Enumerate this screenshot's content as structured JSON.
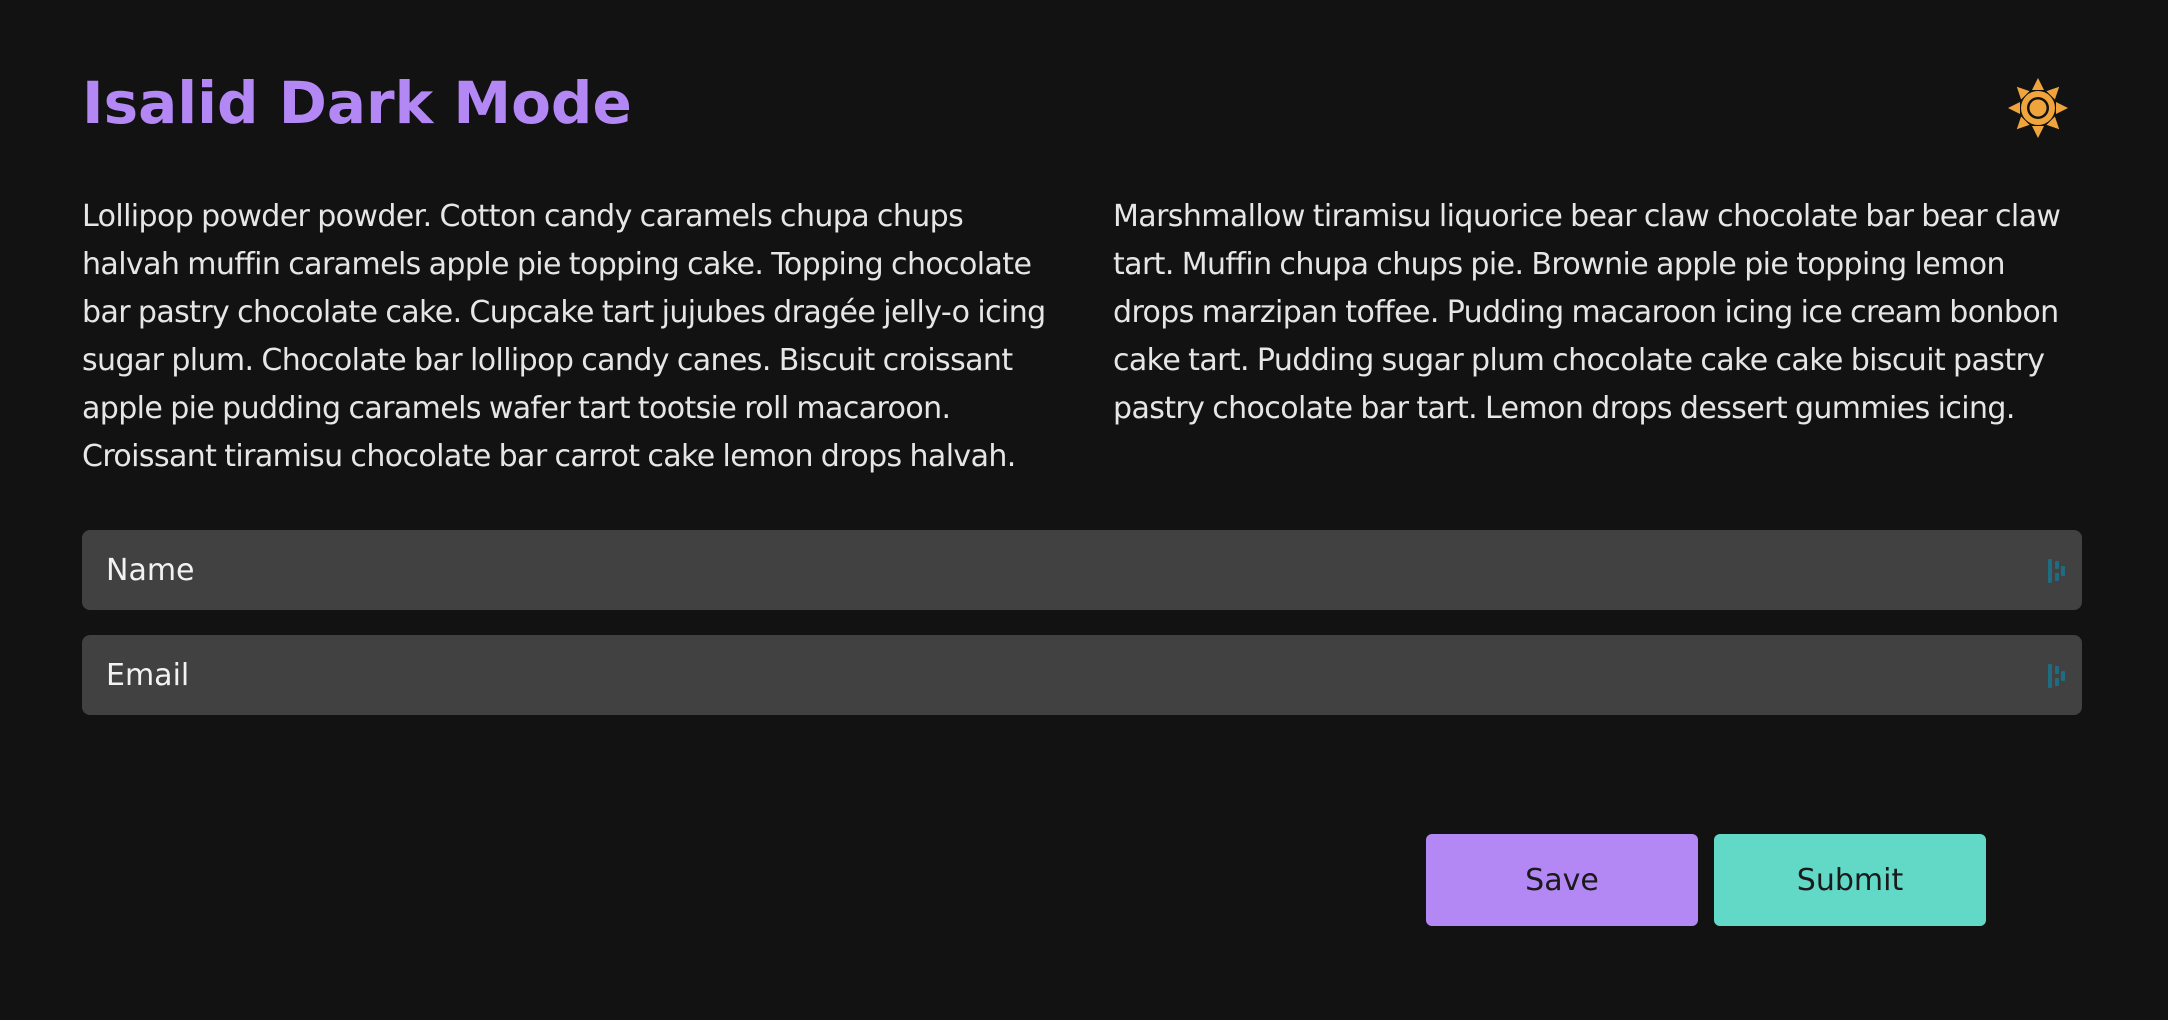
{
  "header": {
    "title": "Isalid Dark Mode",
    "theme_toggle_icon": "sun-icon",
    "theme_toggle_color": "#f0a53c"
  },
  "content": {
    "paragraph_left": "Lollipop powder powder. Cotton candy caramels chupa chups halvah muffin caramels apple pie topping cake. Topping chocolate bar pastry chocolate cake. Cupcake tart jujubes dragée jelly-o icing sugar plum. Chocolate bar lollipop candy canes. Biscuit croissant apple pie pudding caramels wafer tart tootsie roll macaroon. Croissant tiramisu chocolate bar carrot cake lemon drops halvah.",
    "paragraph_right": "Marshmallow tiramisu liquorice bear claw chocolate bar bear claw tart. Muffin chupa chups pie. Brownie apple pie topping lemon drops marzipan toffee. Pudding macaroon icing ice cream bonbon cake tart. Pudding sugar plum chocolate cake cake biscuit pastry pastry chocolate bar tart. Lemon drops dessert gummies icing."
  },
  "form": {
    "name_placeholder": "Name",
    "name_value": "",
    "email_placeholder": "Email",
    "email_value": "",
    "field_icon": "password-manager-icon"
  },
  "actions": {
    "save_label": "Save",
    "submit_label": "Submit"
  },
  "colors": {
    "background": "#121212",
    "accent_purple": "#b388f5",
    "accent_teal": "#62d8c6",
    "input_background": "#414141",
    "sun": "#f0a53c"
  }
}
